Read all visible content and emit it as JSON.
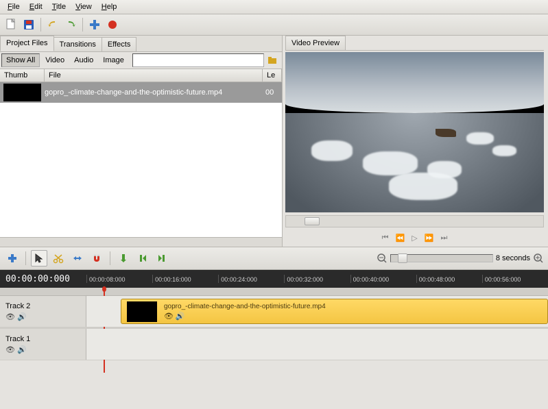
{
  "menu": [
    "File",
    "Edit",
    "Title",
    "View",
    "Help"
  ],
  "left_tabs": [
    "Project Files",
    "Transitions",
    "Effects"
  ],
  "filters": {
    "all": "Show All",
    "video": "Video",
    "audio": "Audio",
    "image": "Image"
  },
  "columns": {
    "thumb": "Thumb",
    "file": "File",
    "len": "Le"
  },
  "files": [
    {
      "name": "gopro_-climate-change-and-the-optimistic-future.mp4",
      "len": "00"
    }
  ],
  "preview_tab": "Video Preview",
  "zoom_label": "8 seconds",
  "timecode": "00:00:00:000",
  "ruler_ticks": [
    "00:00:08:000",
    "00:00:16:000",
    "00:00:24:000",
    "00:00:32:000",
    "00:00:40:000",
    "00:00:48:000",
    "00:00:56:000"
  ],
  "tracks": [
    {
      "name": "Track 2",
      "clip": {
        "title": "gopro_-climate-change-and-the-optimistic-future.mp4"
      }
    },
    {
      "name": "Track 1",
      "clip": null
    }
  ]
}
